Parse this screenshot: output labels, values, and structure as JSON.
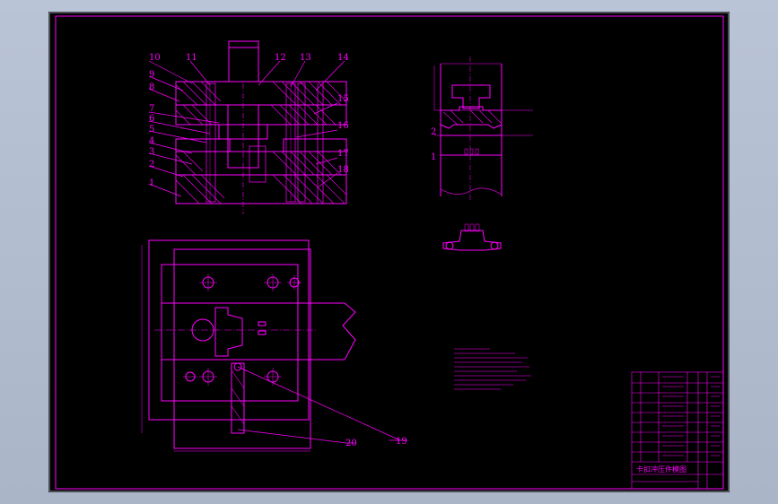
{
  "colors": {
    "background": "#000000",
    "line": "#ff00ff",
    "dim": "#ff00ff",
    "viewport": "#b3bed0"
  },
  "callouts": {
    "c1": "1",
    "c2": "2",
    "c3": "3",
    "c4": "4",
    "c5": "5",
    "c6": "6",
    "c7": "7",
    "c8": "8",
    "c9": "9",
    "c10": "10",
    "c11": "11",
    "c12": "12",
    "c13": "13",
    "c14": "14",
    "c15": "15",
    "c16": "16",
    "c17": "17",
    "c18": "18",
    "c19": "19",
    "c20": "20"
  },
  "part_view": {
    "label_1": "1",
    "label_2": "2"
  },
  "title_block": {
    "drawing_name": "卡扣冲压件模图"
  }
}
